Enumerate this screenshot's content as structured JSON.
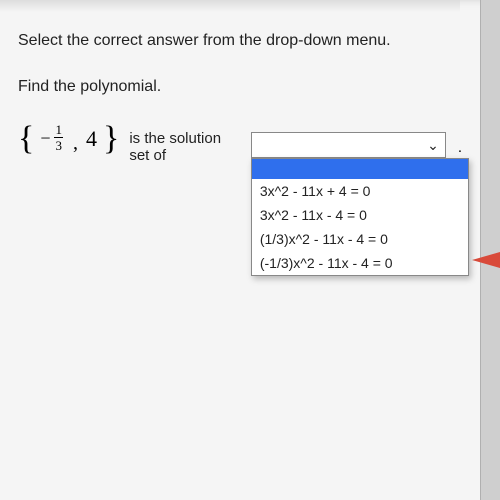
{
  "instruction": "Select the correct answer from the drop-down menu.",
  "subprompt": "Find the polynomial.",
  "set": {
    "neg": "−",
    "frac_num": "1",
    "frac_den": "3",
    "comma": ",",
    "second": "4"
  },
  "solution_text": "is the solution set of",
  "dropdown": {
    "selected": "",
    "options": [
      "",
      "3x^2 - 11x + 4 = 0",
      "3x^2 - 11x - 4 = 0",
      "(1/3)x^2 - 11x - 4 = 0",
      "(-1/3)x^2 - 11x - 4 = 0"
    ]
  },
  "period": "."
}
